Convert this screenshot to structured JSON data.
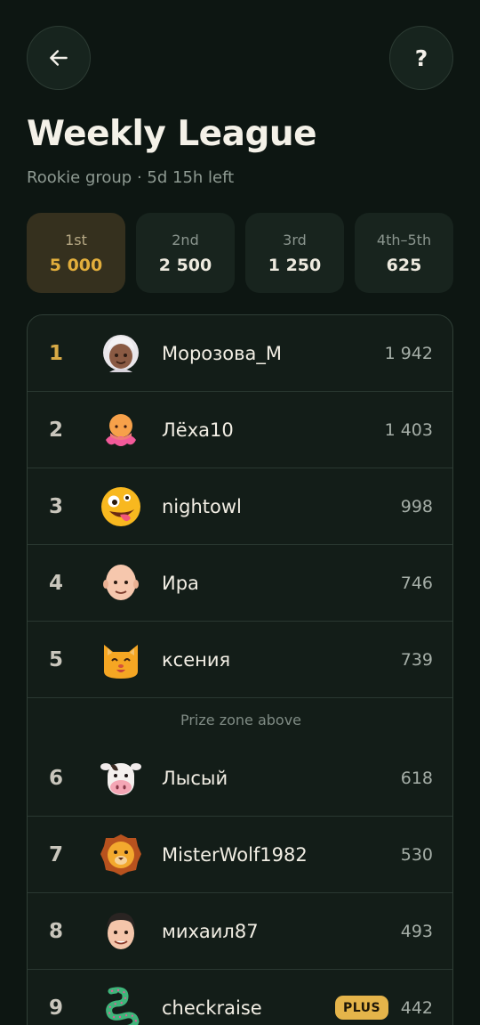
{
  "header": {
    "back_icon": "arrow-left-icon",
    "help_label": "?",
    "title": "Weekly League",
    "subtitle": "Rookie group · 5d 15h left"
  },
  "prizes": [
    {
      "place": "1st",
      "amount": "5 000",
      "highlight": true
    },
    {
      "place": "2nd",
      "amount": "2 500"
    },
    {
      "place": "3rd",
      "amount": "1 250"
    },
    {
      "place": "4th–5th",
      "amount": "625"
    }
  ],
  "leaderboard": {
    "rows": [
      {
        "rank": "1",
        "name": "Морозова_М",
        "score": "1 942",
        "avatar": "grandma-avatar"
      },
      {
        "rank": "2",
        "name": "Лёха10",
        "score": "1 403",
        "avatar": "octopus-avatar"
      },
      {
        "rank": "3",
        "name": "nightowl",
        "score": "998",
        "avatar": "zany-face-avatar"
      },
      {
        "rank": "4",
        "name": "Ира",
        "score": "746",
        "avatar": "bald-person-avatar"
      },
      {
        "rank": "5",
        "name": "ксения",
        "score": "739",
        "avatar": "cat-avatar"
      }
    ],
    "prize_zone_label": "Prize zone above",
    "rows_below": [
      {
        "rank": "6",
        "name": "Лысый",
        "score": "618",
        "avatar": "cow-avatar"
      },
      {
        "rank": "7",
        "name": "MisterWolf1982",
        "score": "530",
        "avatar": "lion-avatar"
      },
      {
        "rank": "8",
        "name": "михаил87",
        "score": "493",
        "avatar": "man-avatar"
      },
      {
        "rank": "9",
        "name": "checkraise",
        "score": "442",
        "avatar": "dragon-avatar",
        "badge": "PLUS"
      }
    ]
  },
  "colors": {
    "background": "#0d1612",
    "gold": "#e2ae3c",
    "plus_badge": "#e5b44a"
  }
}
